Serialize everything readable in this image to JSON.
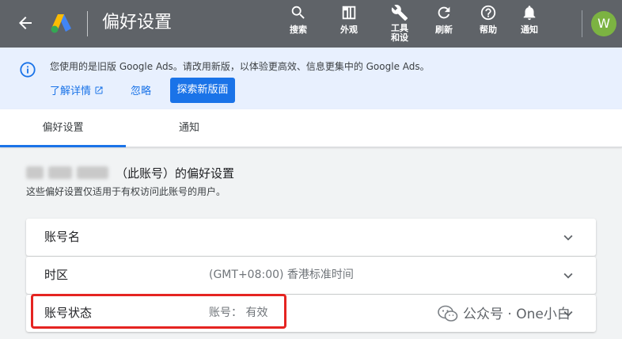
{
  "header": {
    "title": "偏好设置",
    "toolbar": [
      {
        "id": "search",
        "label": "搜索"
      },
      {
        "id": "appearance",
        "label": "外观"
      },
      {
        "id": "tools",
        "label_line1": "工具",
        "label_line2": "和设"
      },
      {
        "id": "refresh",
        "label": "刷新"
      },
      {
        "id": "help",
        "label": "帮助"
      },
      {
        "id": "notifications",
        "label": "通知"
      }
    ],
    "avatar_letter": "W"
  },
  "banner": {
    "message": "您使用的是旧版 Google Ads。请改用新版，以体验更高效、信息更集中的 Google Ads。",
    "learn_more": "了解详情",
    "ignore": "忽略",
    "explore": "探索新版面"
  },
  "tabs": [
    {
      "label": "偏好设置",
      "active": true
    },
    {
      "label": "通知",
      "active": false
    }
  ],
  "content": {
    "heading": "（此账号）的偏好设置",
    "subheading": "这些偏好设置仅适用于有权访问此账号的用户。",
    "rows": [
      {
        "label": "账号名",
        "value": ""
      },
      {
        "label": "时区",
        "value": "(GMT+08:00) 香港标准时间"
      },
      {
        "label": "账号状态",
        "value": "账号：  有效"
      }
    ]
  },
  "watermark": "公众号 · One小白",
  "colors": {
    "topbar": "#5f6368",
    "banner": "#e8f0fe",
    "accent": "#1a73e8",
    "highlight": "#e52421",
    "avatar": "#7cb342"
  }
}
